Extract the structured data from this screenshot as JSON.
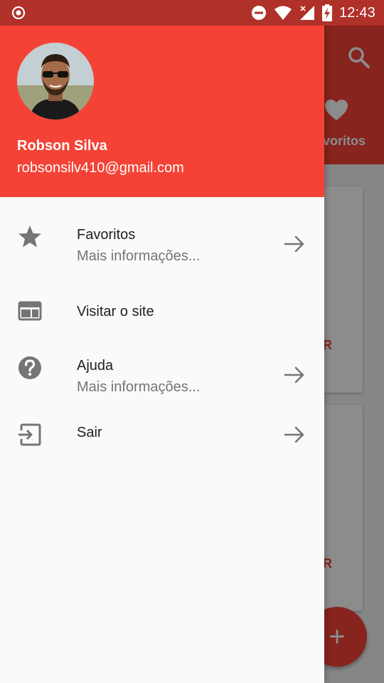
{
  "status_bar": {
    "time": "12:43",
    "icons": [
      "record-icon",
      "do-not-disturb-icon",
      "wifi-icon",
      "signal-icon",
      "battery-charging-icon"
    ]
  },
  "background_app": {
    "tab_label": "voritos",
    "card_button_label": "R",
    "fab_label": "+"
  },
  "drawer": {
    "header": {
      "user_name": "Robson Silva",
      "user_email": "robsonsilv410@gmail.com"
    },
    "items": [
      {
        "title": "Favoritos",
        "subtitle": "Mais informações...",
        "icon": "star-icon",
        "has_arrow": true
      },
      {
        "title": "Visitar o site",
        "icon": "web-icon",
        "has_arrow": false
      },
      {
        "title": "Ajuda",
        "subtitle": "Mais informações...",
        "icon": "help-icon",
        "has_arrow": true
      },
      {
        "title": "Sair",
        "icon": "exit-icon",
        "has_arrow": true
      }
    ]
  },
  "colors": {
    "primary": "#f44336",
    "status_bar": "#b0302a",
    "icon_grey": "#757575"
  }
}
